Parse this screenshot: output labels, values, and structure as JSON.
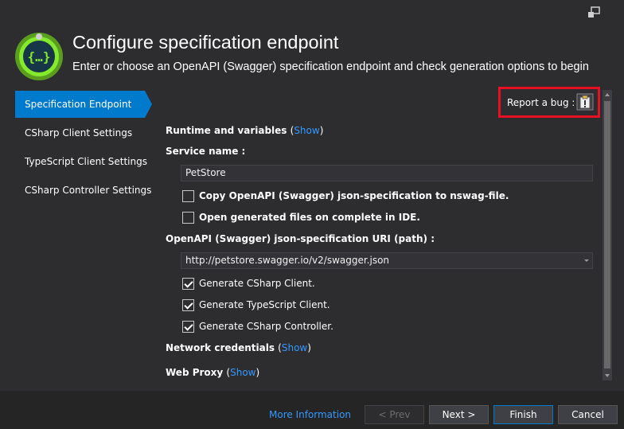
{
  "header": {
    "title": "Configure specification endpoint",
    "subtitle": "Enter or choose an OpenAPI (Swagger) specification endpoint and check generation options to begin"
  },
  "nav": {
    "items": [
      {
        "label": "Specification Endpoint",
        "active": true
      },
      {
        "label": "CSharp Client Settings",
        "active": false
      },
      {
        "label": "TypeScript Client Settings",
        "active": false
      },
      {
        "label": "CSharp Controller Settings",
        "active": false
      }
    ]
  },
  "report_bug": {
    "label": "Report a bug :"
  },
  "runtime": {
    "label": "Runtime and variables",
    "link": "Show"
  },
  "service_name": {
    "label": "Service name :",
    "value": "PetStore"
  },
  "options": {
    "copy_spec": {
      "label": "Copy OpenAPI (Swagger) json-specification to nswag-file.",
      "checked": false
    },
    "open_files": {
      "label": "Open generated files on complete in IDE.",
      "checked": false
    }
  },
  "spec_uri": {
    "label": "OpenAPI (Swagger) json-specification URI (path) :",
    "value": "http://petstore.swagger.io/v2/swagger.json"
  },
  "generate": {
    "csharp_client": {
      "label": "Generate CSharp Client.",
      "checked": true
    },
    "typescript_client": {
      "label": "Generate TypeScript Client.",
      "checked": true
    },
    "csharp_controller": {
      "label": "Generate CSharp Controller.",
      "checked": true
    }
  },
  "network": {
    "label": "Network credentials",
    "link": "Show"
  },
  "proxy": {
    "label": "Web Proxy",
    "link": "Show"
  },
  "footer": {
    "more_info": "More Information",
    "prev": "< Prev",
    "next": "Next >",
    "finish": "Finish",
    "cancel": "Cancel"
  },
  "colors": {
    "accent": "#007acc",
    "highlight_box": "#e81123",
    "link": "#3399ff",
    "background": "#2d2d30"
  }
}
